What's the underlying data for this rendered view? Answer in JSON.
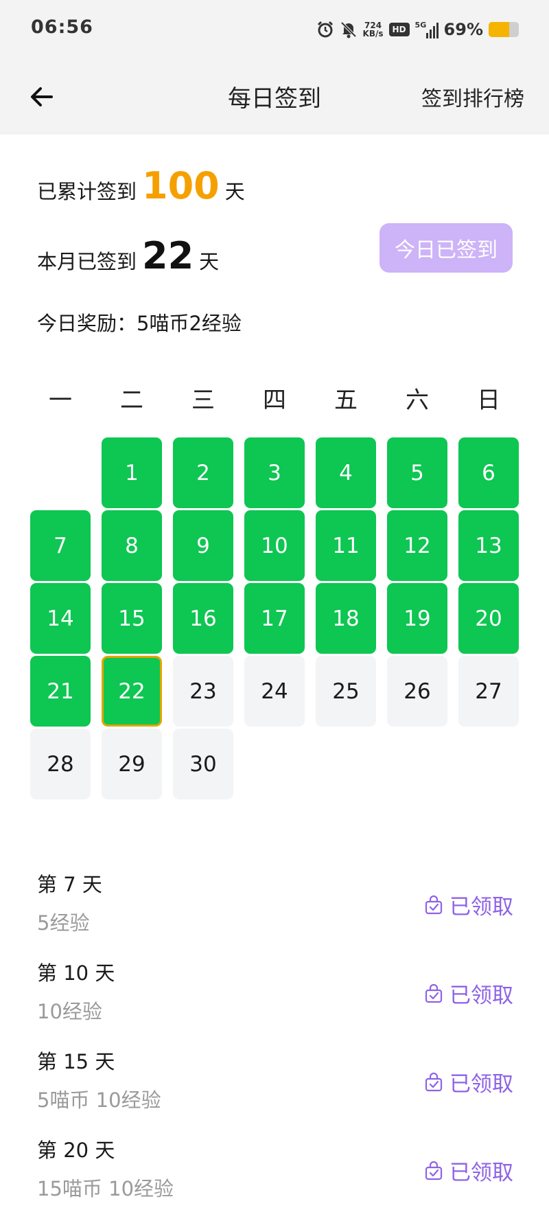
{
  "status_bar": {
    "time": "06:56",
    "net_speed_value": "724",
    "net_speed_unit": "KB/s",
    "hd_label": "HD",
    "network_label": "5G",
    "battery_percent": "69%",
    "battery_level": 0.69,
    "icons": [
      "alarm-icon",
      "bell-off-icon",
      "hd-icon",
      "signal-icon",
      "battery-icon"
    ]
  },
  "nav": {
    "back_icon": "arrow-left-icon",
    "title": "每日签到",
    "rank_label": "签到排行榜"
  },
  "summary": {
    "total_prefix": "已累计签到",
    "total_days": "100",
    "total_suffix": "天",
    "month_prefix": "本月已签到",
    "month_days": "22",
    "month_suffix": "天",
    "reward_label": "今日奖励：",
    "reward_value": "5喵币2经验",
    "checkin_button": "今日已签到"
  },
  "calendar": {
    "weekdays": [
      "一",
      "二",
      "三",
      "四",
      "五",
      "六",
      "日"
    ],
    "first_weekday_index": 1,
    "days_in_month": 30,
    "signed_through": 22,
    "today": 22,
    "colors": {
      "signed": "#0ec652",
      "future": "#f3f4f6",
      "today_border": "#e1a700"
    }
  },
  "rewards": [
    {
      "title": "第 7 天",
      "desc": "5经验",
      "status": "已领取",
      "icon": "gift-bag-check-icon"
    },
    {
      "title": "第 10 天",
      "desc": "10经验",
      "status": "已领取",
      "icon": "gift-bag-check-icon"
    },
    {
      "title": "第 15 天",
      "desc": "5喵币 10经验",
      "status": "已领取",
      "icon": "gift-bag-check-icon"
    },
    {
      "title": "第 20 天",
      "desc": "15喵币 10经验",
      "status": "已领取",
      "icon": "gift-bag-check-icon"
    }
  ],
  "colors": {
    "accent_orange": "#f5a000",
    "accent_purple": "#8e62e6",
    "button_lilac": "#cdb3f7",
    "header_bg": "#f3f3f3"
  }
}
